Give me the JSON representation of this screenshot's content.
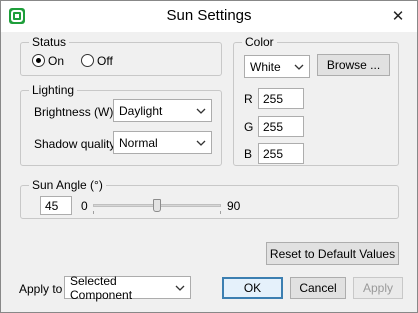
{
  "window": {
    "title": "Sun Settings",
    "close_glyph": "✕"
  },
  "status": {
    "legend": "Status",
    "options": [
      {
        "label": "On",
        "checked": true
      },
      {
        "label": "Off",
        "checked": false
      }
    ]
  },
  "lighting": {
    "legend": "Lighting",
    "brightness_label": "Brightness (W)",
    "brightness_value": "Daylight",
    "shadow_label": "Shadow quality",
    "shadow_value": "Normal"
  },
  "color": {
    "legend": "Color",
    "preset_value": "White",
    "browse_label": "Browse ...",
    "channels": [
      {
        "label": "R",
        "value": "255"
      },
      {
        "label": "G",
        "value": "255"
      },
      {
        "label": "B",
        "value": "255"
      }
    ]
  },
  "sun_angle": {
    "legend": "Sun Angle (°)",
    "value": "45",
    "min_label": "0",
    "max_label": "90",
    "min": 0,
    "max": 90,
    "current": 45
  },
  "reset_label": "Reset to Default Values",
  "apply_to": {
    "label": "Apply to",
    "value": "Selected Component"
  },
  "buttons": {
    "ok": "OK",
    "cancel": "Cancel",
    "apply": "Apply"
  },
  "icons": {
    "app": "sketch-app-icon",
    "close": "close-icon",
    "dropdown": "chevron-down-icon"
  },
  "colors": {
    "accent": "#3c7fb1",
    "app_icon": "#1e9e3a"
  }
}
